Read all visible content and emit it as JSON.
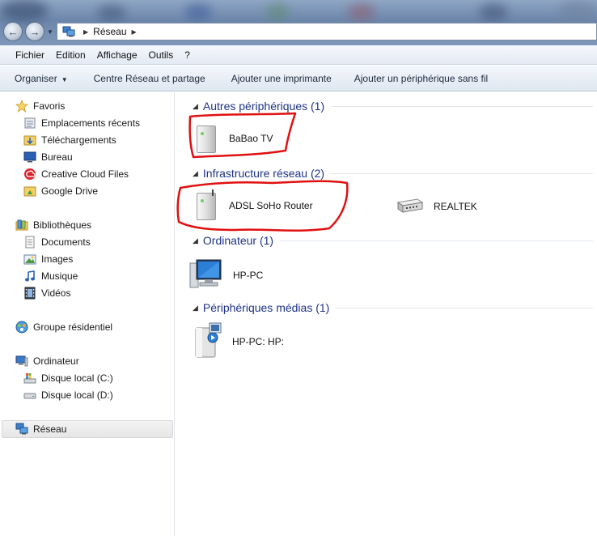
{
  "window": {
    "address": "Réseau"
  },
  "menu": [
    "Fichier",
    "Edition",
    "Affichage",
    "Outils",
    "?"
  ],
  "toolbar": {
    "organize": "Organiser",
    "network_center": "Centre Réseau et partage",
    "add_printer": "Ajouter une imprimante",
    "add_wireless": "Ajouter un périphérique sans fil"
  },
  "sidebar": {
    "favorites": {
      "label": "Favoris",
      "items": [
        "Emplacements récents",
        "Téléchargements",
        "Bureau",
        "Creative Cloud Files",
        "Google Drive"
      ]
    },
    "libraries": {
      "label": "Bibliothèques",
      "items": [
        "Documents",
        "Images",
        "Musique",
        "Vidéos"
      ]
    },
    "homegroup": "Groupe résidentiel",
    "computer": {
      "label": "Ordinateur",
      "items": [
        "Disque local (C:)",
        "Disque local (D:)"
      ]
    },
    "network": "Réseau"
  },
  "groups": [
    {
      "title": "Autres périphériques (1)",
      "items": [
        "BaBao TV"
      ]
    },
    {
      "title": "Infrastructure réseau (2)",
      "items": [
        "ADSL SoHo Router",
        "REALTEK"
      ]
    },
    {
      "title": "Ordinateur (1)",
      "items": [
        "HP-PC"
      ]
    },
    {
      "title": "Périphériques médias (1)",
      "items": [
        "HP-PC: HP:"
      ]
    }
  ],
  "colors": {
    "group_header": "#1e3287",
    "annotation": "#e01010"
  }
}
